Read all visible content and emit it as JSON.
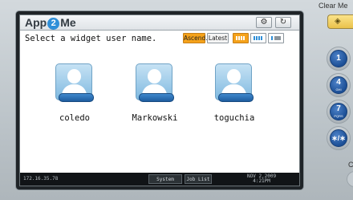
{
  "app": {
    "title_prefix": "App",
    "title_badge": "2",
    "title_suffix": "Me"
  },
  "toolbar": {
    "settings_icon": "gear-icon",
    "refresh_icon": "refresh-icon"
  },
  "prompt": "Select a widget user name.",
  "sort": {
    "ascend_label": "Ascend.",
    "latest_label": "Latest",
    "active": "Ascend."
  },
  "view_modes": [
    "large-icons",
    "small-icons",
    "list"
  ],
  "users": [
    {
      "name": "coledo"
    },
    {
      "name": "Markowski"
    },
    {
      "name": "toguchia"
    }
  ],
  "status": {
    "ip": "172.16.35.78",
    "system_status_label": "System Status",
    "job_list_label": "Job List",
    "date": "NOV   2,2009",
    "time": "4:21PM"
  },
  "panel": {
    "clear_label": "Clear Me",
    "keys": [
      {
        "main": "1",
        "sub": ""
      },
      {
        "main": "4",
        "sub": "GHI"
      },
      {
        "main": "7",
        "sub": "PQRS"
      },
      {
        "main": "∗/∗",
        "sub": ""
      }
    ],
    "partial_label": "C"
  },
  "colors": {
    "accent_orange": "#f5a21a",
    "avatar_blue": "#2f8fd8",
    "key_blue": "#1c4f96"
  }
}
